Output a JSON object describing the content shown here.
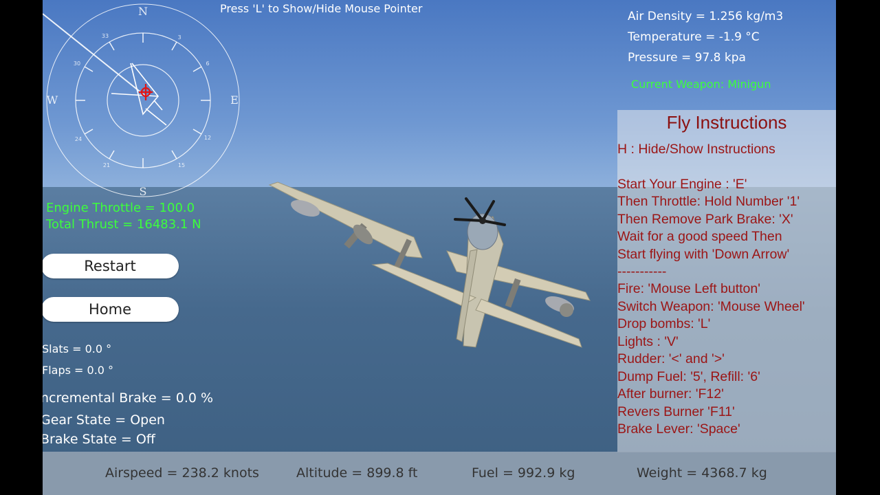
{
  "header": {
    "mouse_hint": "Press 'L' to Show/Hide Mouse Pointer"
  },
  "environment": {
    "air_density": "Air Density = 1.256 kg/m3",
    "temperature": "Temperature = -1.9 °C",
    "pressure": "Pressure = 97.8 kpa",
    "current_weapon": "Current Weapon: Minigun"
  },
  "compass": {
    "cardinals": {
      "n": "N",
      "e": "E",
      "s": "S",
      "w": "W"
    },
    "ticks": [
      "3",
      "6",
      "12",
      "15",
      "21",
      "24",
      "30",
      "33"
    ]
  },
  "engine": {
    "throttle": "Engine Throttle = 100.0",
    "thrust": "Total Thrust = 16483.1 N"
  },
  "buttons": {
    "restart": "Restart",
    "home": "Home"
  },
  "controls": {
    "slats": "Slats = 0.0 °",
    "flaps": "Flaps = 0.0 °",
    "incremental_brake": "ncremental Brake = 0.0 %",
    "gear_state": "Gear State = Open",
    "brake_state": "Brake State = Off"
  },
  "instructions": {
    "title": "Fly Instructions",
    "lines": [
      "H : Hide/Show Instructions",
      "Start Your Engine : 'E'",
      "Then Throttle: Hold Number '1'",
      "Then Remove Park Brake: 'X'",
      "Wait for a good speed Then",
      "Start flying with 'Down Arrow'",
      "-----------",
      "Fire: 'Mouse Left button'",
      "Switch Weapon: 'Mouse Wheel'",
      "Drop bombs: 'L'",
      "Lights : 'V'",
      "Rudder: '<' and '>'",
      "Dump Fuel: '5', Refill: '6'",
      "After burner: 'F12'",
      "Revers Burner 'F11'",
      "Brake Lever: 'Space'"
    ]
  },
  "stats": {
    "airspeed": "Airspeed = 238.2 knots",
    "altitude": "Altitude = 899.8 ft",
    "fuel": "Fuel = 992.9 kg",
    "weight": "Weight = 4368.7 kg"
  }
}
